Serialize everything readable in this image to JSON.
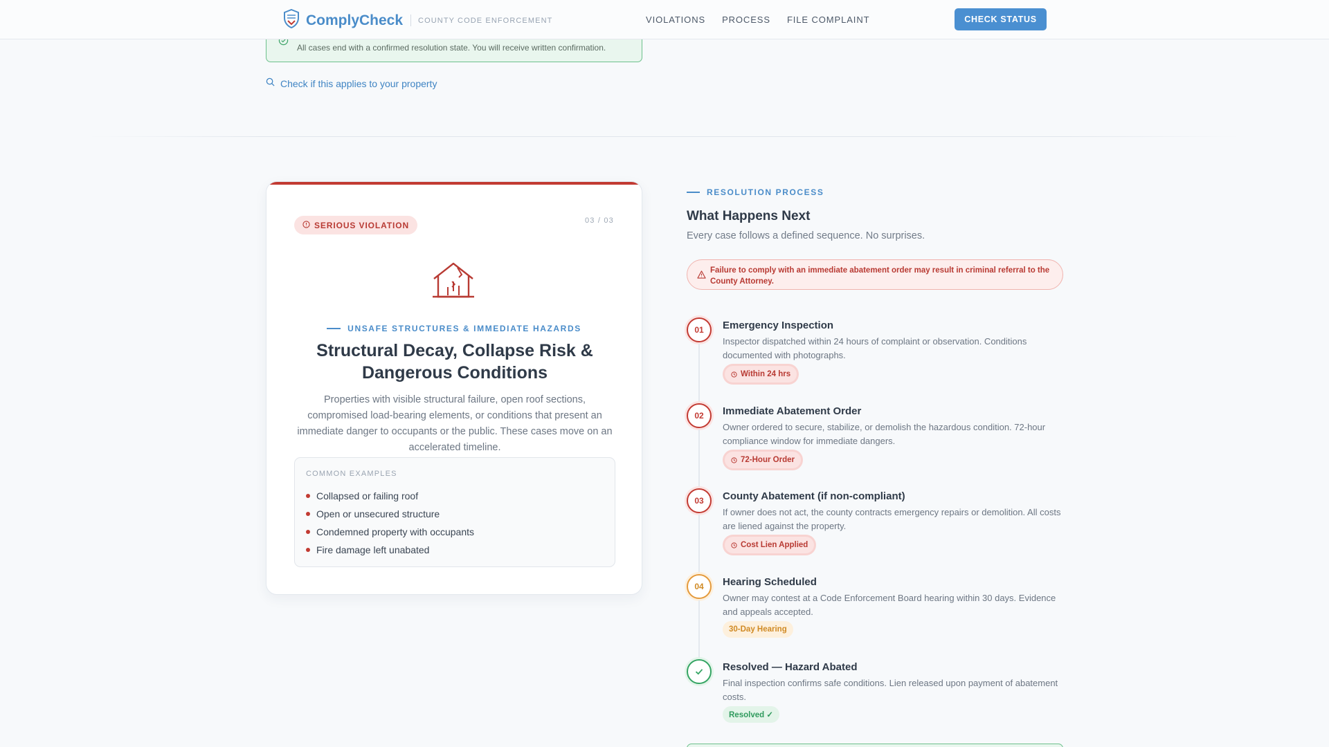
{
  "nav": {
    "brand": "ComplyCheck",
    "tagline": "COUNTY CODE ENFORCEMENT",
    "links": [
      "VIOLATIONS",
      "PROCESS",
      "FILE COMPLAINT"
    ],
    "cta": "CHECK STATUS"
  },
  "top": {
    "confirm_text": "All cases end with a confirmed resolution state. You will receive written confirmation.",
    "applies_link": "Check if this applies to your property"
  },
  "card": {
    "badge": "SERIOUS VIOLATION",
    "count": "03 / 03",
    "eyebrow": "UNSAFE STRUCTURES & IMMEDIATE HAZARDS",
    "title": "Structural Decay, Collapse Risk & Dangerous Conditions",
    "description": "Properties with visible structural failure, open roof sections, compromised load-bearing elements, or conditions that present an immediate danger to occupants or the public. These cases move on an accelerated timeline.",
    "examples_title": "COMMON EXAMPLES",
    "examples": [
      "Collapsed or failing roof",
      "Open or unsecured structure",
      "Condemned property with occupants",
      "Fire damage left unabated"
    ]
  },
  "process": {
    "eyebrow": "RESOLUTION PROCESS",
    "title": "What Happens Next",
    "subtitle": "Every case follows a defined sequence. No surprises.",
    "alert": "Failure to comply with an immediate abatement order may result in criminal referral to the County Attorney.",
    "steps": [
      {
        "num": "01",
        "title": "Emergency Inspection",
        "desc": "Inspector dispatched within 24 hours of complaint or observation. Conditions documented with photographs.",
        "tag": "Within 24 hrs"
      },
      {
        "num": "02",
        "title": "Immediate Abatement Order",
        "desc": "Owner ordered to secure, stabilize, or demolish the hazardous condition. 72-hour compliance window for immediate dangers.",
        "tag": "72-Hour Order"
      },
      {
        "num": "03",
        "title": "County Abatement (if non-compliant)",
        "desc": "If owner does not act, the county contracts emergency repairs or demolition. All costs are liened against the property.",
        "tag": "Cost Lien Applied"
      },
      {
        "num": "04",
        "title": "Hearing Scheduled",
        "desc": "Owner may contest at a Code Enforcement Board hearing within 30 days. Evidence and appeals accepted.",
        "tag": "30-Day Hearing"
      },
      {
        "num": "",
        "title": "Resolved — Hazard Abated",
        "desc": "Final inspection confirms safe conditions. Lien released upon payment of abatement costs.",
        "tag": "Resolved ✓"
      }
    ]
  },
  "colors": {
    "brand": "#4a8cc9",
    "danger": "#c23a32",
    "warning": "#d08a24",
    "success": "#34a463"
  }
}
